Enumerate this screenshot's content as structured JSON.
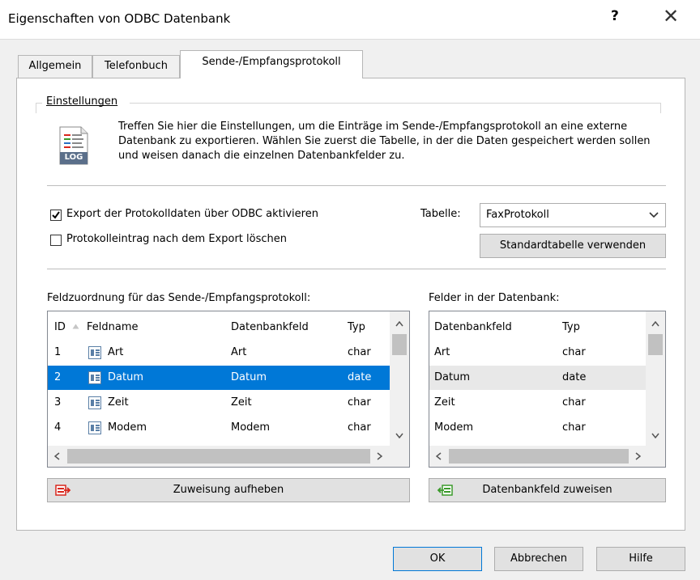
{
  "window": {
    "title": "Eigenschaften von ODBC Datenbank",
    "help_glyph": "?",
    "close_glyph": "✕"
  },
  "tabs": [
    "Allgemein",
    "Telefonbuch",
    "Sende-/Empfangsprotokoll"
  ],
  "active_tab": "Sende-/Empfangsprotokoll",
  "settings": {
    "group_label": "Einstellungen",
    "icon_label": "LOG",
    "description": "Treffen Sie hier die Einstellungen, um die Einträge im Sende-/Empfangsprotokoll an eine externe Datenbank zu exportieren. Wählen Sie zuerst die Tabelle, in der die Daten gespeichert werden sollen und weisen danach die einzelnen Datenbankfelder zu.",
    "export_checkbox": {
      "label": "Export der Protokolldaten über ODBC aktivieren",
      "checked": true
    },
    "delete_checkbox": {
      "label": "Protokolleintrag nach dem Export löschen",
      "checked": false
    },
    "table_label": "Tabelle:",
    "table_value": "FaxProtokoll",
    "default_table_button": "Standardtabelle verwenden"
  },
  "mapping": {
    "label": "Feldzuordnung für das Sende-/Empfangsprotokoll:",
    "columns": {
      "id": "ID",
      "feldname": "Feldname",
      "datenbankfeld": "Datenbankfeld",
      "typ": "Typ"
    },
    "rows": [
      {
        "id": "1",
        "feldname": "Art",
        "datenbankfeld": "Art",
        "typ": "char"
      },
      {
        "id": "2",
        "feldname": "Datum",
        "datenbankfeld": "Datum",
        "typ": "date",
        "selected": true
      },
      {
        "id": "3",
        "feldname": "Zeit",
        "datenbankfeld": "Zeit",
        "typ": "char"
      },
      {
        "id": "4",
        "feldname": "Modem",
        "datenbankfeld": "Modem",
        "typ": "char"
      }
    ],
    "button": "Zuweisung aufheben"
  },
  "db_fields": {
    "label": "Felder in der Datenbank:",
    "columns": {
      "datenbankfeld": "Datenbankfeld",
      "typ": "Typ"
    },
    "rows": [
      {
        "datenbankfeld": "Art",
        "typ": "char"
      },
      {
        "datenbankfeld": "Datum",
        "typ": "date",
        "highlighted": true
      },
      {
        "datenbankfeld": "Zeit",
        "typ": "char"
      },
      {
        "datenbankfeld": "Modem",
        "typ": "char"
      }
    ],
    "button": "Datenbankfeld zuweisen"
  },
  "footer": {
    "ok": "OK",
    "cancel": "Abbrechen",
    "help": "Hilfe"
  },
  "colors": {
    "selection": "#0078d7",
    "accent_red": "#d9261c",
    "accent_green": "#3a9a2a"
  }
}
